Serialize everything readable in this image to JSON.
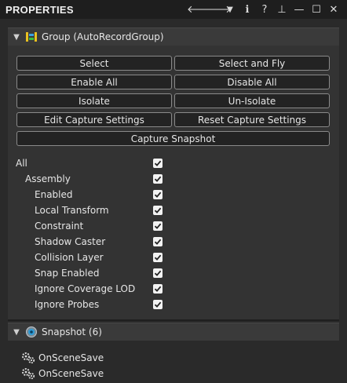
{
  "window": {
    "title": "PROPERTIES",
    "icons": [
      "back-arrow-icon",
      "forward-arrow-icon",
      "dropdown-triangle-icon",
      "info-icon",
      "help-icon",
      "pin-icon",
      "minimize-icon",
      "maximize-icon",
      "close-icon"
    ],
    "glyphs": {
      "back": "🡐",
      "forward": "🡒",
      "dropdown": "▼",
      "info": "ℹ",
      "help": "?",
      "pin": "⊥",
      "minimize": "—",
      "maximize": "☐",
      "close": "✕"
    }
  },
  "group_section": {
    "header": "Group (AutoRecordGroup)",
    "buttons": {
      "select": "Select",
      "select_and_fly": "Select and Fly",
      "enable_all": "Enable All",
      "disable_all": "Disable All",
      "isolate": "Isolate",
      "un_isolate": "Un-Isolate",
      "edit_capture_settings": "Edit Capture Settings",
      "reset_capture_settings": "Reset Capture Settings",
      "capture_snapshot": "Capture Snapshot"
    },
    "checklist": [
      {
        "label": "All",
        "checked": true
      },
      {
        "label": "Assembly",
        "checked": true
      },
      {
        "label": "Enabled",
        "checked": true
      },
      {
        "label": "Local Transform",
        "checked": true
      },
      {
        "label": "Constraint",
        "checked": true
      },
      {
        "label": "Shadow Caster",
        "checked": true
      },
      {
        "label": "Collision Layer",
        "checked": true
      },
      {
        "label": "Snap Enabled",
        "checked": true
      },
      {
        "label": "Ignore Coverage LOD",
        "checked": true
      },
      {
        "label": "Ignore Probes",
        "checked": true
      }
    ]
  },
  "snapshot_section": {
    "header": "Snapshot (6)",
    "items": [
      "OnSceneSave",
      "OnSceneSave"
    ]
  },
  "colors": {
    "background": "#2a2a2a",
    "titlebar": "#1e1e1e",
    "section_header": "#3a3a3a",
    "button_bg": "#232323",
    "button_border": "#8a8a8a",
    "checkbox": "#f2f2f2"
  }
}
